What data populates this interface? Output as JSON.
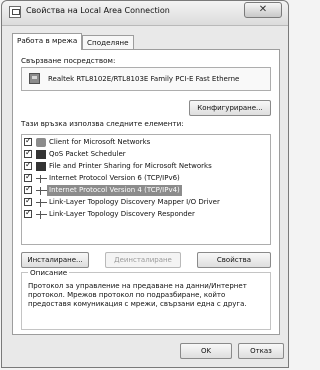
{
  "window": {
    "title": "Свойства на Local Area Connection",
    "close_label": "✕"
  },
  "tabs": [
    {
      "label": "Работа в мрежа"
    },
    {
      "label": "Споделяне"
    }
  ],
  "connect_using": {
    "label": "Свързване посредством:",
    "adapter_name": "Realtek RTL8102E/RTL8103E Family PCI-E Fast Etherne",
    "configure_button": "Конфигуриране..."
  },
  "items_section": {
    "label": "Тази връзка използва следните елементи:",
    "items": [
      {
        "name": "Client for Microsoft Networks",
        "icon": "client-icon",
        "checked": true
      },
      {
        "name": "QoS Packet Scheduler",
        "icon": "scheduler-icon",
        "checked": true
      },
      {
        "name": "File and Printer Sharing for Microsoft Networks",
        "icon": "printer-icon",
        "checked": true
      },
      {
        "name": "Internet Protocol Version 6 (TCP/IPv6)",
        "icon": "protocol-icon",
        "checked": true
      },
      {
        "name": "Internet Protocol Version 4 (TCP/IPv4)",
        "icon": "protocol-icon",
        "checked": true,
        "selected": true
      },
      {
        "name": "Link-Layer Topology Discovery Mapper I/O Driver",
        "icon": "protocol-icon",
        "checked": true
      },
      {
        "name": "Link-Layer Topology Discovery Responder",
        "icon": "protocol-icon",
        "checked": true
      }
    ]
  },
  "buttons": {
    "install": "Инсталиране...",
    "uninstall": "Деинсталиране",
    "properties": "Свойства"
  },
  "description": {
    "legend": "Описание",
    "text": "Протокол за управление на предаване на данни/Интернет протокол. Мрежов протокол по подразбиране, който предоставя комуникация с мрежи, свързани една с друга."
  },
  "footer": {
    "ok": "OK",
    "cancel": "Отказ"
  }
}
